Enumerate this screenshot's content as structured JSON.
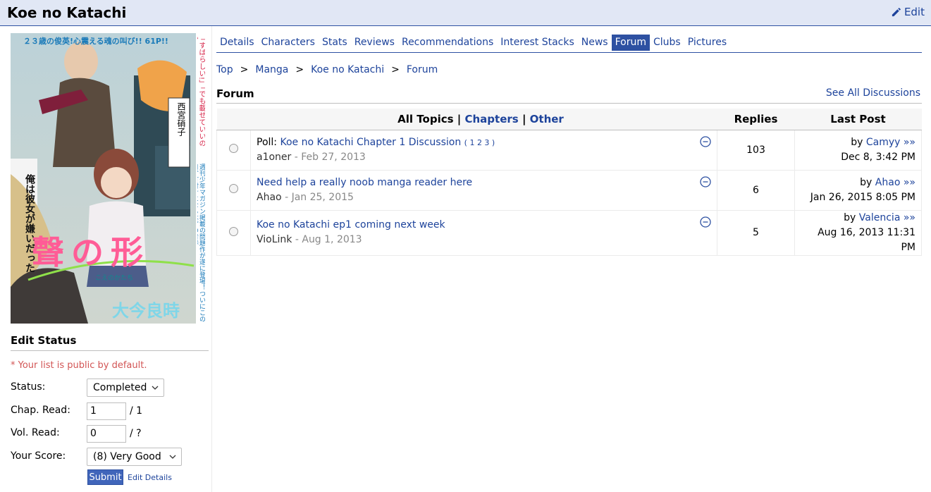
{
  "page": {
    "title": "Koe no Katachi",
    "edit_label": "Edit"
  },
  "cover": {
    "right_text_1": "「すばらしい!」「でも載せていいのか!?」",
    "top_text": "２３歳の俊英!心震える魂の叫び!! 61P!!",
    "name_card": "西宮硝子",
    "left_text": "俺は彼女が嫌いだった",
    "logo_title": "聲の形",
    "logo_reading": "こえのかたち",
    "author": "大今良時",
    "side_text": "週刊少年マガジン掲載の問題作が遂に登場！ついにこの日、釘付けになるはずの青春！"
  },
  "sidebar": {
    "edit_status_title": "Edit Status",
    "public_note": "* Your list is public by default.",
    "status_label": "Status:",
    "status_value": "Completed",
    "chap_label": "Chap. Read:",
    "chap_value": "1",
    "chap_total": "/ 1",
    "vol_label": "Vol. Read:",
    "vol_value": "0",
    "vol_total": "/ ?",
    "score_label": "Your Score:",
    "score_value": "(8) Very Good",
    "submit_label": "Submit",
    "edit_details_label": "Edit Details"
  },
  "tabs": [
    {
      "label": "Details"
    },
    {
      "label": "Characters"
    },
    {
      "label": "Stats"
    },
    {
      "label": "Reviews"
    },
    {
      "label": "Recommendations"
    },
    {
      "label": "Interest Stacks"
    },
    {
      "label": "News"
    },
    {
      "label": "Forum"
    },
    {
      "label": "Clubs"
    },
    {
      "label": "Pictures"
    }
  ],
  "breadcrumb": {
    "items": [
      "Top",
      "Manga",
      "Koe no Katachi",
      "Forum"
    ],
    "separator": ">"
  },
  "forum": {
    "title": "Forum",
    "see_all": "See All Discussions",
    "headers": {
      "all_topics": "All Topics",
      "sep": "|",
      "chapters": "Chapters",
      "other": "Other",
      "replies": "Replies",
      "last_post": "Last Post"
    },
    "rows": [
      {
        "prefix": "Poll:",
        "title": "Koe no Katachi Chapter 1 Discussion",
        "pages": "( 1 2 3 )",
        "author": "a1oner",
        "date": "- Feb 27, 2013",
        "replies": "103",
        "last_by": "by",
        "last_user": "Camyy",
        "last_arrow": "»»",
        "last_date": "Dec 8, 3:42 PM"
      },
      {
        "prefix": "",
        "title": "Need help a really noob manga reader here",
        "pages": "",
        "author": "Ahao",
        "date": "- Jan 25, 2015",
        "replies": "6",
        "last_by": "by",
        "last_user": "Ahao",
        "last_arrow": "»»",
        "last_date": "Jan 26, 2015 8:05 PM"
      },
      {
        "prefix": "",
        "title": "Koe no Katachi ep1 coming next week",
        "pages": "",
        "author": "VioLink",
        "date": "- Aug 1, 2013",
        "replies": "5",
        "last_by": "by",
        "last_user": "Valencia",
        "last_arrow": "»»",
        "last_date": "Aug 16, 2013 11:31 PM"
      }
    ]
  },
  "colors": {
    "accent": "#2e51a2",
    "link": "#1d439b",
    "header_bg": "#e1e7f5",
    "note_red": "#d25555"
  }
}
